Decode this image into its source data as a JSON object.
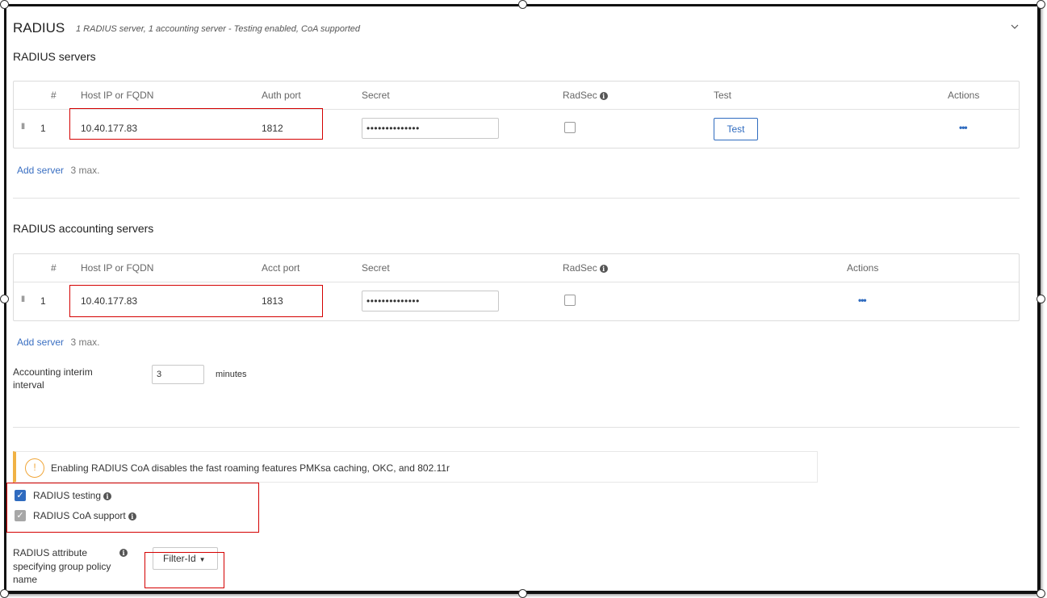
{
  "header": {
    "title": "RADIUS",
    "summary": "1 RADIUS server, 1 accounting server - Testing enabled, CoA supported"
  },
  "auth_section": {
    "heading": "RADIUS servers",
    "columns": [
      "#",
      "Host IP or FQDN",
      "Auth port",
      "Secret",
      "RadSec",
      "Test",
      "Actions"
    ],
    "rows": [
      {
        "drag": "II",
        "index": "1",
        "host": "10.40.177.83",
        "port": "1812",
        "secret": "••••••••••••••",
        "radsec": false,
        "test_label": "Test",
        "actions": "•••"
      }
    ],
    "add_server_label": "Add server",
    "max_label": "3 max."
  },
  "acct_section": {
    "heading": "RADIUS accounting servers",
    "columns": [
      "#",
      "Host IP or FQDN",
      "Acct port",
      "Secret",
      "RadSec",
      "Actions"
    ],
    "rows": [
      {
        "drag": "II",
        "index": "1",
        "host": "10.40.177.83",
        "port": "1813",
        "secret": "••••••••••••••",
        "radsec": false,
        "actions": "•••"
      }
    ],
    "add_server_label": "Add server",
    "max_label": "3 max."
  },
  "interim": {
    "label_line1": "Accounting interim",
    "label_line2": "interval",
    "value": "3",
    "unit": "minutes"
  },
  "coa_warning": {
    "icon": "warning-icon",
    "text": "Enabling RADIUS CoA disables the fast roaming features PMKsa caching, OKC, and 802.11r"
  },
  "options": {
    "testing_label": "RADIUS testing",
    "testing_checked": true,
    "coa_label": "RADIUS CoA support",
    "coa_checked": true
  },
  "group_policy": {
    "label_line1": "RADIUS attribute",
    "label_line2": "specifying group policy",
    "label_line3": "name",
    "selected": "Filter-Id"
  },
  "colors": {
    "accent": "#2f6bbf",
    "checkbox_active": "#2f6bbf",
    "checkbox_disabled": "#a7a7a7",
    "warning": "#f0b245",
    "highlight": "#d40000"
  }
}
